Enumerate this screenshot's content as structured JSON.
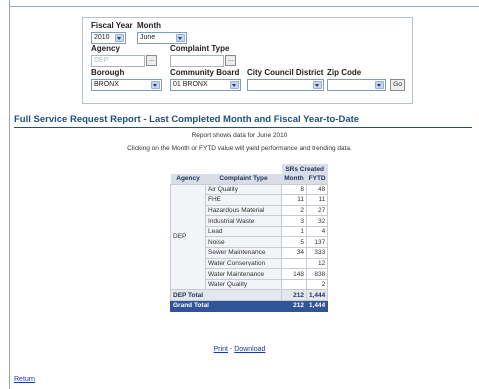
{
  "filters": {
    "fiscal_year": {
      "label": "Fiscal Year",
      "value": "2010"
    },
    "month": {
      "label": "Month",
      "value": "June"
    },
    "agency": {
      "label": "Agency",
      "value": "DEP"
    },
    "complaint_type": {
      "label": "Complaint Type",
      "value": ""
    },
    "borough": {
      "label": "Borough",
      "value": "BRONX"
    },
    "community_board": {
      "label": "Community Board",
      "value": "01 BRONX"
    },
    "council_district": {
      "label": "City Council District",
      "value": ""
    },
    "zip_code": {
      "label": "Zip Code",
      "value": ""
    },
    "lookup_label": "...",
    "go_label": "Go"
  },
  "report": {
    "title": "Full Service Request Report - Last Completed Month and Fiscal Year-to-Date",
    "note_data": "Report shows data for June 2010",
    "note_click": "Clicking on the Month or FYTD value will yield performance and trending data."
  },
  "table": {
    "group_header": "SRs Created",
    "headers": {
      "agency": "Agency",
      "type": "Complaint Type",
      "month": "Month",
      "fytd": "FYTD"
    },
    "agency": "DEP",
    "rows": [
      {
        "type": "Air Quality",
        "month": "8",
        "fytd": "48"
      },
      {
        "type": "FHE",
        "month": "11",
        "fytd": "11"
      },
      {
        "type": "Hazardous Material",
        "month": "2",
        "fytd": "27"
      },
      {
        "type": "Industrial Waste",
        "month": "3",
        "fytd": "32"
      },
      {
        "type": "Lead",
        "month": "1",
        "fytd": "4"
      },
      {
        "type": "Noise",
        "month": "5",
        "fytd": "137"
      },
      {
        "type": "Sewer Maintenance",
        "month": "34",
        "fytd": "333"
      },
      {
        "type": "Water Conservation",
        "month": "",
        "fytd": "12"
      },
      {
        "type": "Water Maintenance",
        "month": "148",
        "fytd": "838"
      },
      {
        "type": "Water Quality",
        "month": "",
        "fytd": "2"
      }
    ],
    "dep_total": {
      "label": "DEP Total",
      "month": "212",
      "fytd": "1,444"
    },
    "grand_total": {
      "label": "Grand Total",
      "month": "212",
      "fytd": "1,444"
    }
  },
  "links": {
    "print": "Print",
    "separator": " - ",
    "download": "Download",
    "return": "Return"
  }
}
